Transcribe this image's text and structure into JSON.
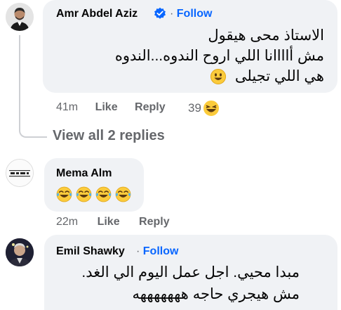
{
  "comments": [
    {
      "author": "Amr Abdel Aziz",
      "verified": true,
      "follow_label": "Follow",
      "separator": "·",
      "lines": [
        "الاستاذ محى هيقول",
        "مش أاااانا اللي اروح الندوه...الندوه",
        "هي اللي تجيلى"
      ],
      "time": "41m",
      "like_label": "Like",
      "reply_label": "Reply",
      "reactions_count": "39"
    },
    {
      "view_replies_label": "View all 2 replies"
    },
    {
      "author": "Mema Alm",
      "time": "22m",
      "like_label": "Like",
      "reply_label": "Reply"
    },
    {
      "author": "Emil Shawky",
      "follow_label": "Follow",
      "separator": "·",
      "lines": [
        "مبدا محيي. اجل عمل اليوم الي الغد.",
        "مش هيجري حاجه هههههههه"
      ]
    }
  ],
  "colors": {
    "bubble": "#f0f2f5",
    "follow": "#0866ff",
    "meta": "#65676b",
    "emoji": "#fbcb3b"
  },
  "icons": [
    "verified-badge-icon",
    "smiley-emoji-icon",
    "laughing-tears-emoji-icon",
    "haha-reaction-icon"
  ]
}
